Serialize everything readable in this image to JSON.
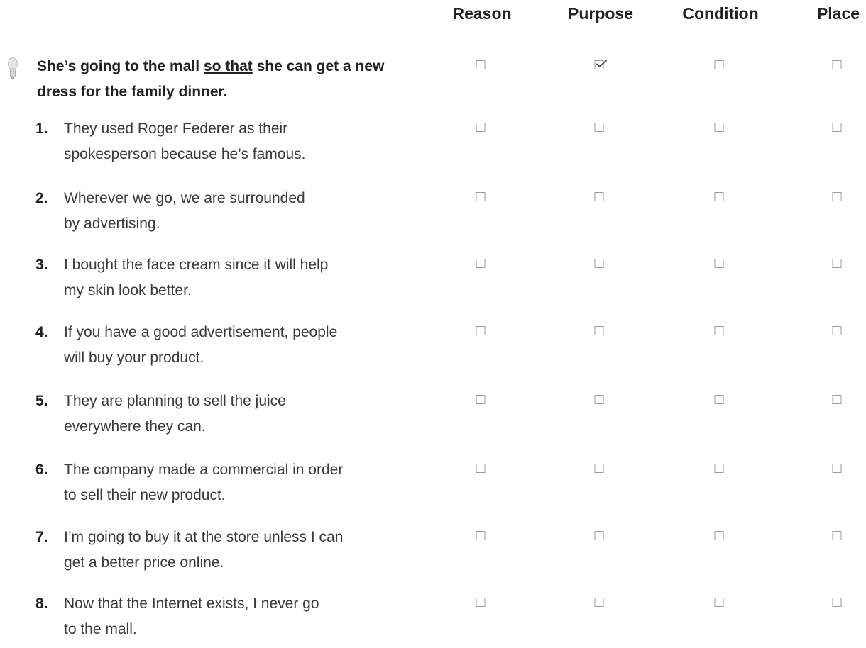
{
  "columns": [
    "Reason",
    "Purpose",
    "Condition",
    "Place"
  ],
  "example": {
    "before": "She’s going to the mall ",
    "underlined": "so that",
    "after": " she can get a new dress for the family dinner.",
    "answer": "Purpose",
    "icon": "lightbulb-icon"
  },
  "items": [
    {
      "num": "1.",
      "line1": "They used Roger Federer as their",
      "line2": "spokesperson because he’s famous."
    },
    {
      "num": "2.",
      "line1": "Wherever we go, we are surrounded",
      "line2": "by advertising."
    },
    {
      "num": "3.",
      "line1": "I bought the face cream since it will help",
      "line2": "my skin look better."
    },
    {
      "num": "4.",
      "line1": "If you have a good advertisement, people",
      "line2": "will buy your product."
    },
    {
      "num": "5.",
      "line1": "They are planning to sell the juice",
      "line2": "everywhere they can."
    },
    {
      "num": "6.",
      "line1": "The company made a commercial in order",
      "line2": "to sell their new product."
    },
    {
      "num": "7.",
      "line1": "I’m going to buy it at the store unless I can",
      "line2": "get a better price online."
    },
    {
      "num": "8.",
      "line1": "Now that the Internet exists, I never go",
      "line2": "to the mall."
    }
  ]
}
